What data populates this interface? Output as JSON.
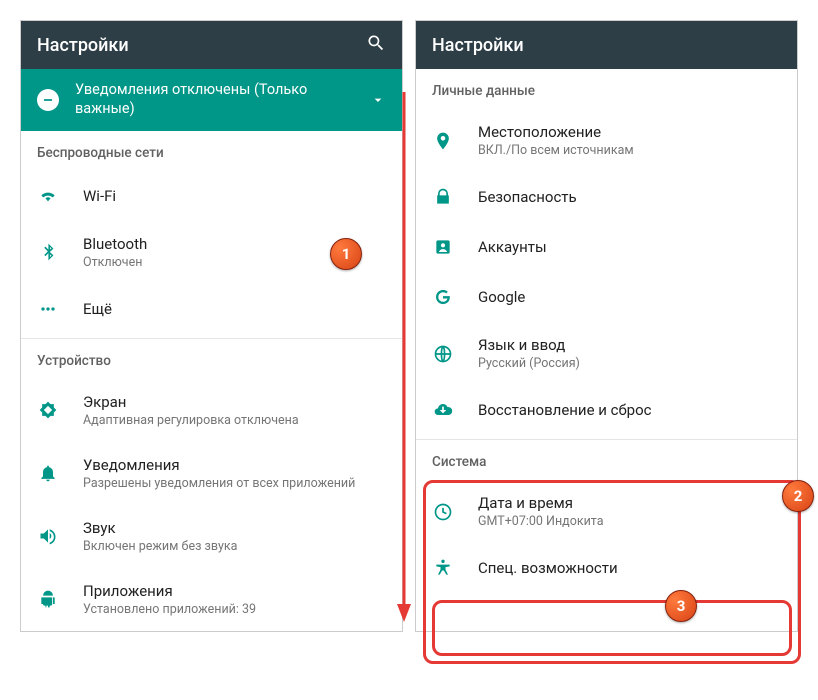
{
  "left": {
    "appbar_title": "Настройки",
    "banner_text": "Уведомления отключены (Только важные)",
    "sections": {
      "wireless_header": "Беспроводные сети",
      "wifi": "Wi-Fi",
      "bt_title": "Bluetooth",
      "bt_sub": "Отключен",
      "more": "Ещё",
      "device_header": "Устройство",
      "display_title": "Экран",
      "display_sub": "Адаптивная регулировка отключена",
      "notif_title": "Уведомления",
      "notif_sub": "Разрешены уведомления от всех приложений",
      "sound_title": "Звук",
      "sound_sub": "Включен режим без звука",
      "apps_title": "Приложения",
      "apps_sub": "Установлено приложений: 39"
    }
  },
  "right": {
    "appbar_title": "Настройки",
    "sections": {
      "personal_header": "Личные данные",
      "location_title": "Местоположение",
      "location_sub": "ВКЛ./По всем источникам",
      "security": "Безопасность",
      "accounts": "Аккаунты",
      "google": "Google",
      "lang_title": "Язык и ввод",
      "lang_sub": "Русский (Россия)",
      "backup": "Восстановление и сброс",
      "system_header": "Система",
      "date_title": "Дата и время",
      "date_sub": "GMT+07:00 Индокита",
      "access": "Спец. возможности"
    }
  },
  "callouts": {
    "one": "1",
    "two": "2",
    "three": "3"
  }
}
